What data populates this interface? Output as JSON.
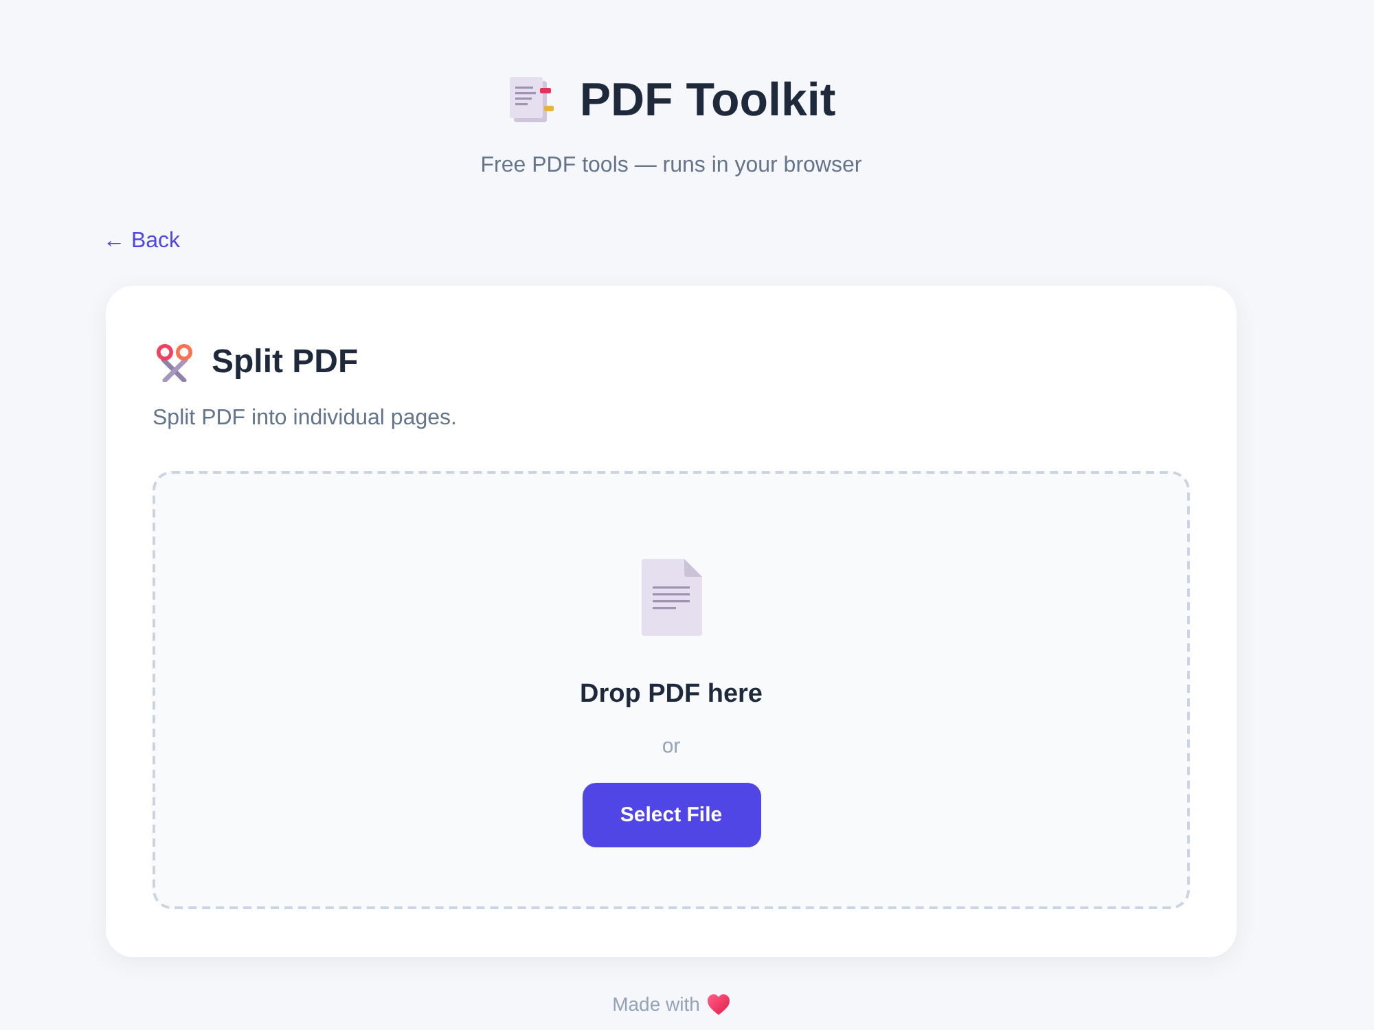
{
  "header": {
    "title": "PDF Toolkit",
    "subtitle": "Free PDF tools — runs in your browser"
  },
  "back_link": {
    "label": "← Back"
  },
  "tool": {
    "title": "Split PDF",
    "description": "Split PDF into individual pages.",
    "dropzone": {
      "prompt": "Drop PDF here",
      "separator": "or",
      "button": "Select File"
    }
  },
  "footer": {
    "text": "Made with"
  }
}
